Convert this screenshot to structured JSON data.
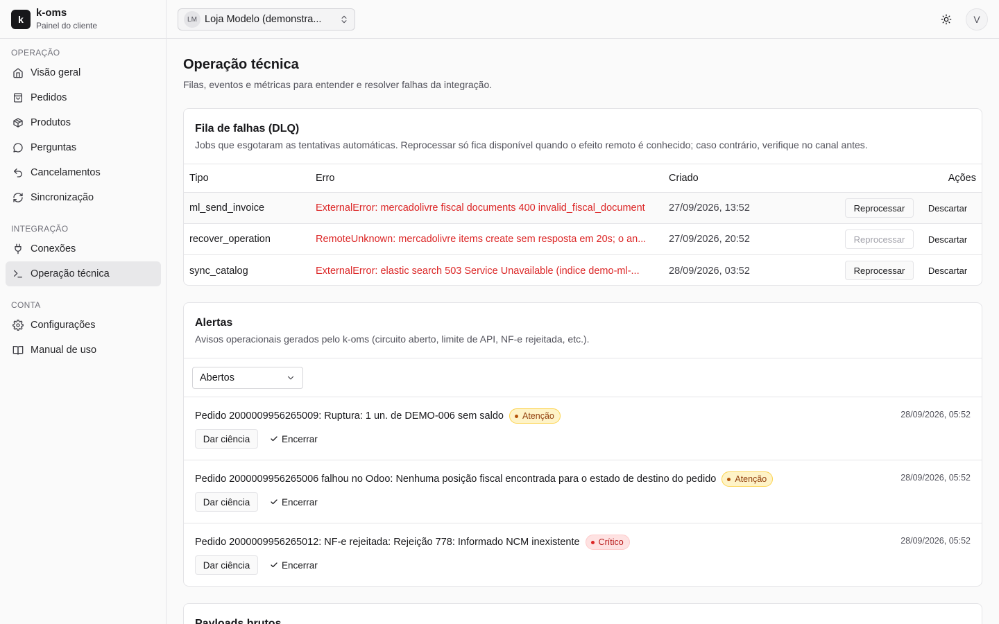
{
  "brand": {
    "logo": "k",
    "name": "k-oms",
    "subtitle": "Painel do cliente"
  },
  "sidebar": {
    "sections": [
      {
        "heading": "OPERAÇÃO",
        "items": [
          {
            "label": "Visão geral",
            "icon": "home-icon"
          },
          {
            "label": "Pedidos",
            "icon": "shopping-bag-icon"
          },
          {
            "label": "Produtos",
            "icon": "package-icon"
          },
          {
            "label": "Perguntas",
            "icon": "message-circle-icon"
          },
          {
            "label": "Cancelamentos",
            "icon": "undo-icon"
          },
          {
            "label": "Sincronização",
            "icon": "refresh-icon"
          }
        ]
      },
      {
        "heading": "INTEGRAÇÃO",
        "items": [
          {
            "label": "Conexões",
            "icon": "plug-icon"
          },
          {
            "label": "Operação técnica",
            "icon": "terminal-icon",
            "active": true
          }
        ]
      },
      {
        "heading": "CONTA",
        "items": [
          {
            "label": "Configurações",
            "icon": "settings-icon"
          },
          {
            "label": "Manual de uso",
            "icon": "book-icon"
          }
        ]
      }
    ]
  },
  "topbar": {
    "store_initials": "LM",
    "store_name": "Loja Modelo (demonstra...",
    "theme_icon": "sun-icon",
    "user_initial": "V"
  },
  "page": {
    "title": "Operação técnica",
    "subtitle": "Filas, eventos e métricas para entender e resolver falhas da integração."
  },
  "dlq": {
    "title": "Fila de falhas (DLQ)",
    "description": "Jobs que esgotaram as tentativas automáticas. Reprocessar só fica disponível quando o efeito remoto é conhecido; caso contrário, verifique no canal antes.",
    "columns": {
      "tipo": "Tipo",
      "erro": "Erro",
      "criado": "Criado",
      "acoes": "Ações"
    },
    "reprocess_label": "Reprocessar",
    "discard_label": "Descartar",
    "rows": [
      {
        "tipo": "ml_send_invoice",
        "erro": "ExternalError: mercadolivre fiscal documents 400 invalid_fiscal_document",
        "criado": "27/09/2026, 13:52",
        "reprocess_enabled": true
      },
      {
        "tipo": "recover_operation",
        "erro": "RemoteUnknown: mercadolivre items create sem resposta em 20s; o an...",
        "criado": "27/09/2026, 20:52",
        "reprocess_enabled": false
      },
      {
        "tipo": "sync_catalog",
        "erro": "ExternalError: elastic search 503 Service Unavailable (indice demo-ml-...",
        "criado": "28/09/2026, 03:52",
        "reprocess_enabled": true
      }
    ]
  },
  "alerts": {
    "title": "Alertas",
    "description": "Avisos operacionais gerados pelo k-oms (circuito aberto, limite de API, NF-e rejeitada, etc.).",
    "filter_value": "Abertos",
    "ack_label": "Dar ciência",
    "close_label": "Encerrar",
    "items": [
      {
        "message": "Pedido 2000009956265009: Ruptura: 1 un. de DEMO-006 sem saldo",
        "severity": "Atenção",
        "level": "warn",
        "time": "28/09/2026, 05:52"
      },
      {
        "message": "Pedido 2000009956265006 falhou no Odoo: Nenhuma posição fiscal encontrada para o estado de destino do pedido",
        "severity": "Atenção",
        "level": "warn",
        "time": "28/09/2026, 05:52"
      },
      {
        "message": "Pedido 2000009956265012: NF-e rejeitada: Rejeição 778: Informado NCM inexistente",
        "severity": "Crítico",
        "level": "crit",
        "time": "28/09/2026, 05:52"
      }
    ]
  },
  "payloads": {
    "title": "Payloads brutos"
  }
}
